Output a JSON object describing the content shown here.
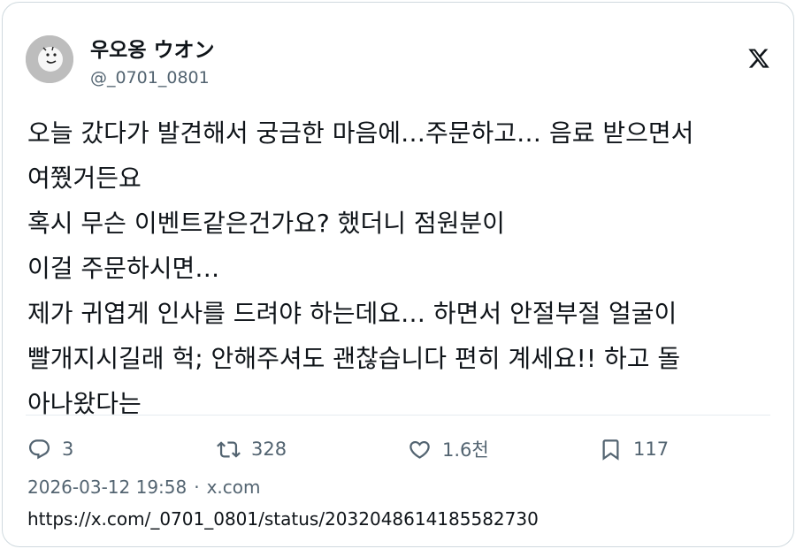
{
  "author": {
    "display_name": "우오옹 ウオン",
    "handle": "@_0701_0801"
  },
  "icons": {
    "brand": "x-logo-icon",
    "avatar": "avatar-face-icon",
    "reply": "reply-icon",
    "retweet": "retweet-icon",
    "like": "heart-icon",
    "bookmark": "bookmark-icon"
  },
  "tweet": {
    "lines": [
      "오늘 갔다가 발견해서 궁금한 마음에…주문하고… 음료 받으면서",
      "여쭸거든요",
      "혹시 무슨 이벤트같은건가요? 했더니 점원분이",
      "이걸 주문하시면…",
      "제가 귀엽게 인사를 드려야 하는데요… 하면서 안절부절 얼굴이",
      "빨개지시길래 헉; 안해주셔도 괜찮습니다 편히 계세요!! 하고 돌",
      "아나왔다는"
    ]
  },
  "stats": {
    "replies": "3",
    "retweets": "328",
    "likes": "1.6천",
    "bookmarks": "117"
  },
  "meta": {
    "timestamp": "2026-03-12 19:58",
    "separator": "·",
    "source": "x.com",
    "url": "https://x.com/_0701_0801/status/2032048614185582730"
  },
  "colors": {
    "text": "#0f1419",
    "secondary": "#536471",
    "border": "#cfd9de",
    "avatar_bg": "#bdbdbd"
  }
}
